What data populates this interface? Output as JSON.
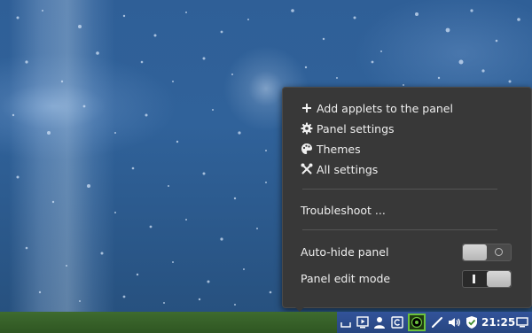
{
  "panel_context_menu": {
    "items": [
      {
        "label": "Add applets to the panel",
        "icon": "plus-icon"
      },
      {
        "label": "Panel settings",
        "icon": "gear-icon"
      },
      {
        "label": "Themes",
        "icon": "palette-icon"
      },
      {
        "label": "All settings",
        "icon": "tools-icon"
      }
    ],
    "troubleshoot_label": "Troubleshoot ...",
    "toggles": [
      {
        "label": "Auto-hide panel",
        "state": "off"
      },
      {
        "label": "Panel edit mode",
        "state": "on"
      }
    ]
  },
  "taskbar": {
    "clock": "21:25",
    "tray_icons": [
      "show-desktop-icon",
      "media-player-icon",
      "user-icon",
      "update-manager-icon",
      "screenshot-recorder-icon",
      "pen-icon",
      "volume-icon",
      "security-shield-icon",
      "workspace-switcher-icon"
    ],
    "colors": {
      "panel_left": "#3e6b2f",
      "tray": "#32539a"
    }
  },
  "colors": {
    "menu_background": "#383838",
    "menu_text": "#eeeeee",
    "desktop": "#2f5f97"
  }
}
